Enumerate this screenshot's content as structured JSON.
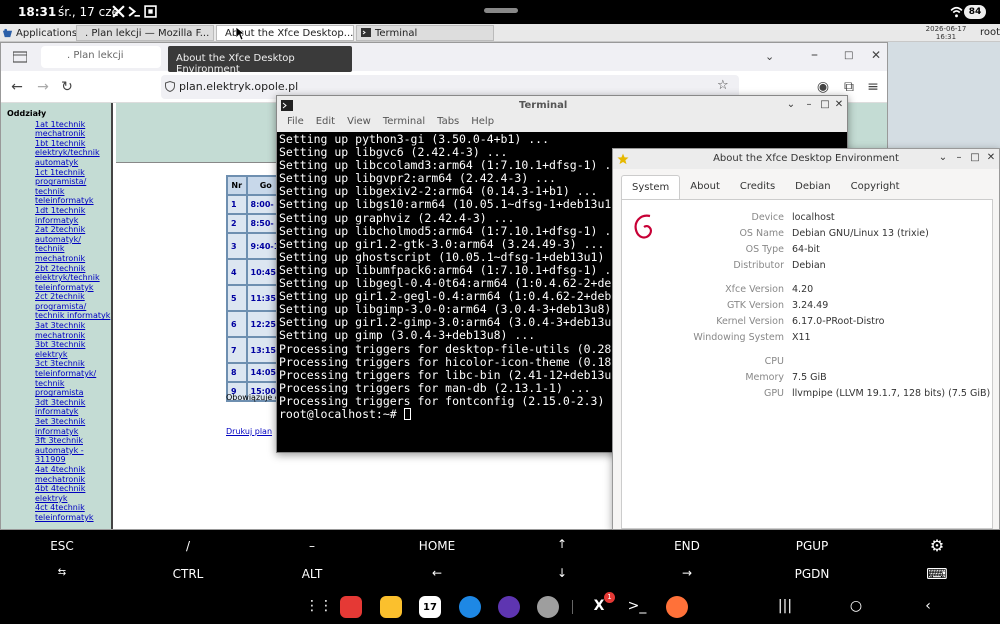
{
  "statusbar": {
    "time": "18:31",
    "date": "śr., 17 cze",
    "battery": "84"
  },
  "panel": {
    "applications": "Applications",
    "tasks": [
      {
        "label": ". Plan lekcji — Mozilla F..."
      },
      {
        "label": "About the Xfce Desktop..."
      },
      {
        "label": "Terminal"
      }
    ],
    "clock_date": "2026-06-17",
    "clock_time": "16:31",
    "user": "root"
  },
  "firefox": {
    "tab_title": ". Plan lekcji",
    "url": "plan.elektryk.opole.pl",
    "tooltip": "About the Xfce Desktop Environment",
    "page": {
      "left_header": "Oddziały",
      "classes": [
        "1at 1technik mechatronik",
        "1bt 1technik elektryk/technik automatyk",
        "1ct 1technik programista/ technik teleinformatyk",
        "1dt 1technik informatyk",
        "2at 2technik automatyk/ technik mechatronik",
        "2bt 2technik elektryk/technik teleinformatyk",
        "2ct 2technik programista/ technik informatyk",
        "3at 3technik mechatronik",
        "3bt 3technik elektryk",
        "3ct 3technik teleinformatyk/ technik programista",
        "3dt 3technik informatyk",
        "3et 3technik informatyk",
        "3ft 3technik automatyk - 311909",
        "4at 4technik mechatronik",
        "4bt 4technik elektryk",
        "4ct 4technik teleinformatyk"
      ],
      "table_headers": [
        "Nr",
        "Go"
      ],
      "table_rows": [
        [
          "1",
          "8:00-"
        ],
        [
          "2",
          "8:50-"
        ],
        [
          "3",
          "9:40-1"
        ],
        [
          "4",
          "10:45-"
        ],
        [
          "5",
          "11:35-"
        ],
        [
          "6",
          "12:25-"
        ],
        [
          "7",
          "13:15-"
        ],
        [
          "8",
          "14:05-"
        ],
        [
          "9",
          "15:00-"
        ]
      ],
      "obowiazuje": "Obowiązuje o",
      "drukuj": "Drukuj plan"
    }
  },
  "terminal": {
    "title": "Terminal",
    "menu": [
      "File",
      "Edit",
      "View",
      "Terminal",
      "Tabs",
      "Help"
    ],
    "lines": [
      "Setting up python3-gi (3.50.0-4+b1) ...",
      "Setting up libgvc6 (2.42.4-3) ...",
      "Setting up libccolamd3:arm64 (1:7.10.1+dfsg-1) ...",
      "Setting up libgvpr2:arm64 (2.42.4-3) ...",
      "Setting up libgexiv2-2:arm64 (0.14.3-1+b1) ...",
      "Setting up libgs10:arm64 (10.05.1~dfsg-1+deb13u1",
      "Setting up graphviz (2.42.4-3) ...",
      "Setting up libcholmod5:arm64 (1:7.10.1+dfsg-1) .",
      "Setting up gir1.2-gtk-3.0:arm64 (3.24.49-3) ...",
      "Setting up ghostscript (10.05.1~dfsg-1+deb13u1)",
      "Setting up libumfpack6:arm64 (1:7.10.1+dfsg-1) .",
      "Setting up libgegl-0.4-0t64:arm64 (1:0.4.62-2+de",
      "Setting up gir1.2-gegl-0.4:arm64 (1:0.4.62-2+deb",
      "Setting up libgimp-3.0-0:arm64 (3.0.4-3+deb13u8)",
      "Setting up gir1.2-gimp-3.0:arm64 (3.0.4-3+deb13u",
      "Setting up gimp (3.0.4-3+deb13u8) ...",
      "Processing triggers for desktop-file-utils (0.28",
      "Processing triggers for hicolor-icon-theme (0.18",
      "Processing triggers for libc-bin (2.41-12+deb13u",
      "Processing triggers for man-db (2.13.1-1) ...",
      "Processing triggers for fontconfig (2.15.0-2.3)",
      "root@localhost:~# "
    ]
  },
  "about": {
    "title": "About the Xfce Desktop Environment",
    "tabs": [
      "System",
      "About",
      "Credits",
      "Debian",
      "Copyright"
    ],
    "rows": [
      {
        "k": "Device",
        "v": "localhost"
      },
      {
        "k": "OS Name",
        "v": "Debian GNU/Linux 13 (trixie)"
      },
      {
        "k": "OS Type",
        "v": "64-bit"
      },
      {
        "k": "Distributor",
        "v": "Debian"
      },
      {
        "k": "Xfce Version",
        "v": "4.20"
      },
      {
        "k": "GTK Version",
        "v": "3.24.49"
      },
      {
        "k": "Kernel Version",
        "v": "6.17.0-PRoot-Distro"
      },
      {
        "k": "Windowing System",
        "v": "X11"
      },
      {
        "k": "CPU",
        "v": ""
      },
      {
        "k": "Memory",
        "v": "7.5 GiB"
      },
      {
        "k": "GPU",
        "v": "llvmpipe (LLVM 19.1.7, 128 bits) (7.5 GiB)"
      }
    ]
  },
  "extrakeys": {
    "row1": [
      "ESC",
      "/",
      "–",
      "HOME",
      "↑",
      "END",
      "PGUP",
      "⚙"
    ],
    "row2": [
      "⇆",
      "CTRL",
      "ALT",
      "←",
      "↓",
      "→",
      "PGDN",
      "⌨"
    ]
  },
  "dock": {
    "calendar_day": "17",
    "badge": "1"
  }
}
